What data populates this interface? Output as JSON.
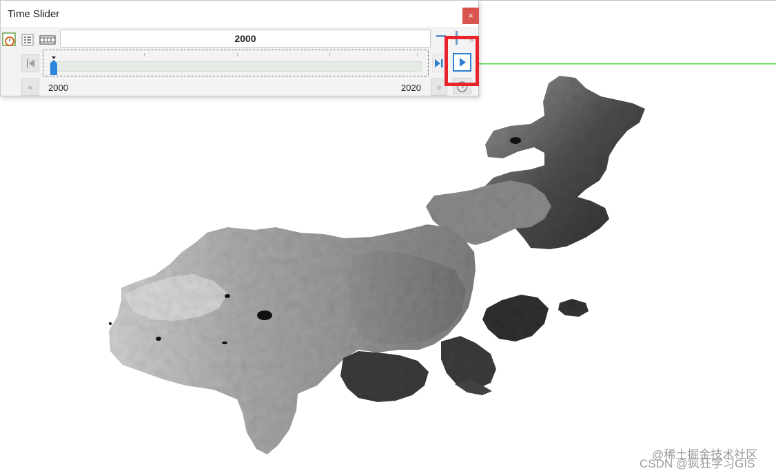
{
  "window": {
    "title": "Time Slider",
    "close_glyph": "×"
  },
  "toolbar": {
    "icons": [
      "time-slider-options-icon",
      "layer-properties-icon",
      "film-export-icon"
    ]
  },
  "time_display": {
    "current_time": "2000"
  },
  "slider": {
    "start_label": "2000",
    "end_label": "2020",
    "position_fraction": 0.0
  },
  "nav": {
    "back_glyph": "«",
    "forward_glyph": "»"
  },
  "highlight": {
    "color": "#e8232a",
    "target": "play-button"
  },
  "colors": {
    "play_accent": "#2c7fd6",
    "green_line": "#3ddc3d"
  },
  "watermark": {
    "line1": "@稀土掘金技术社区",
    "line2": "CSDN @疯狂学习GIS"
  }
}
